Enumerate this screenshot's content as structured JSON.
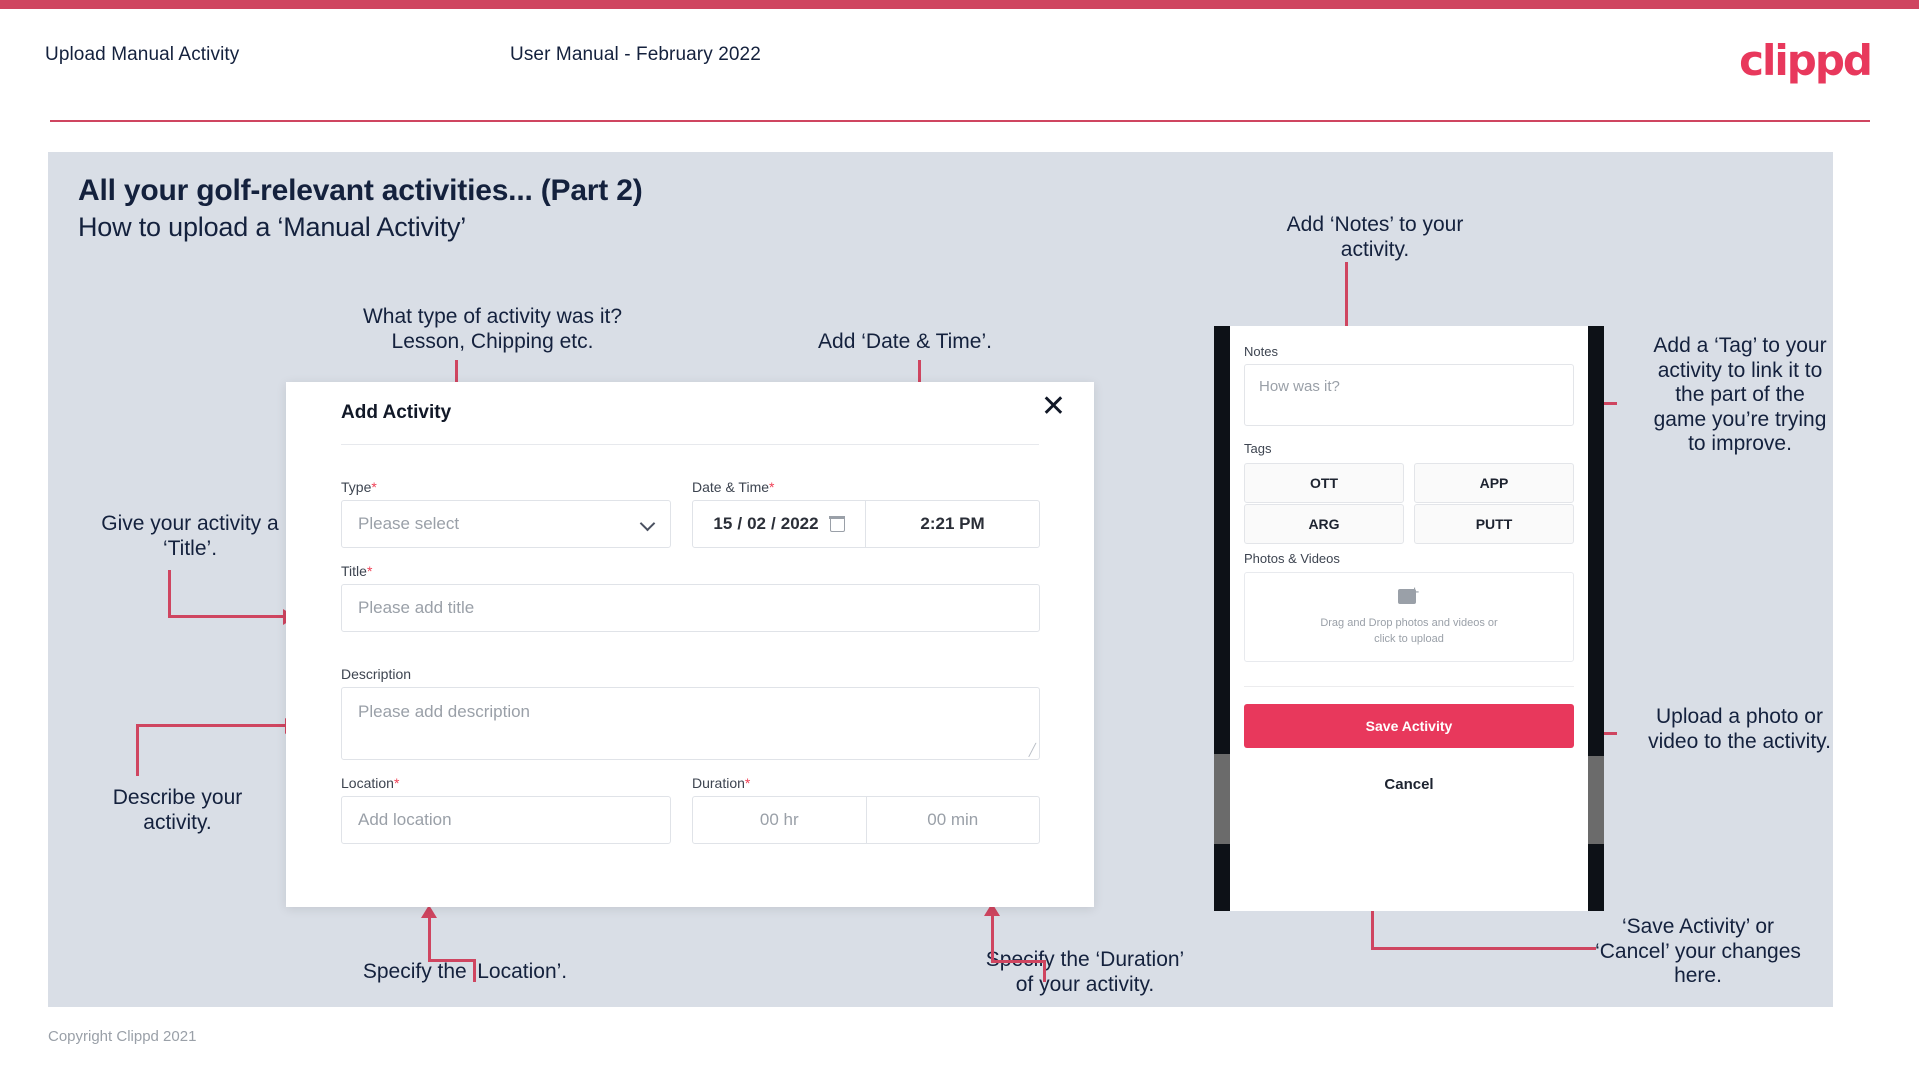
{
  "header": {
    "title": "Upload Manual Activity",
    "subtitle": "User Manual - February 2022",
    "logo": "clippd"
  },
  "slide": {
    "title": "All your golf-relevant activities... (Part 2)",
    "subtitle": "How to upload a ‘Manual Activity’"
  },
  "footer": {
    "copyright": "Copyright Clippd 2021"
  },
  "colors": {
    "brand_pink": "#e8385c",
    "rule_red": "#cf4560",
    "slide_bg": "#d9dee6",
    "text_navy": "#14213d",
    "required_red": "#ef4056"
  },
  "dialog": {
    "title": "Add Activity",
    "close_icon": "close-icon",
    "fields": {
      "type": {
        "label": "Type",
        "required": "*",
        "placeholder": "Please select"
      },
      "datetime": {
        "label": "Date & Time",
        "required": "*",
        "day": "15",
        "sep1": "/",
        "month": "02",
        "sep2": "/",
        "year": "2022",
        "time": "2:21 PM"
      },
      "title": {
        "label": "Title",
        "required": "*",
        "placeholder": "Please add title"
      },
      "description": {
        "label": "Description",
        "required": "",
        "placeholder": "Please add description"
      },
      "location": {
        "label": "Location",
        "required": "*",
        "placeholder": "Add location"
      },
      "duration": {
        "label": "Duration",
        "required": "*",
        "hours": "00 hr",
        "minutes": "00 min"
      }
    }
  },
  "phone": {
    "notes": {
      "label": "Notes",
      "placeholder": "How was it?"
    },
    "tags": {
      "label": "Tags",
      "items": [
        "OTT",
        "APP",
        "ARG",
        "PUTT"
      ]
    },
    "photos": {
      "label": "Photos & Videos",
      "drop_line1": "Drag and Drop photos and videos or",
      "drop_line2": "click to upload",
      "icon": "image-add-icon"
    },
    "save_label": "Save Activity",
    "cancel_label": "Cancel"
  },
  "annotations": {
    "type": "What type of activity was it?\nLesson, Chipping etc.",
    "datetime": "Add ‘Date & Time’.",
    "title": "Give your activity a\n‘Title’.",
    "description": "Describe your\nactivity.",
    "location": "Specify the ‘Location’.",
    "duration": "Specify the ‘Duration’\nof your activity.",
    "notes": "Add ‘Notes’ to your\nactivity.",
    "tags": "Add a ‘Tag’ to your\nactivity to link it to\nthe part of the\ngame you’re trying\nto improve.",
    "photos": "Upload a photo or\nvideo to the activity.",
    "save": "‘Save Activity’ or\n‘Cancel’ your changes\nhere."
  }
}
